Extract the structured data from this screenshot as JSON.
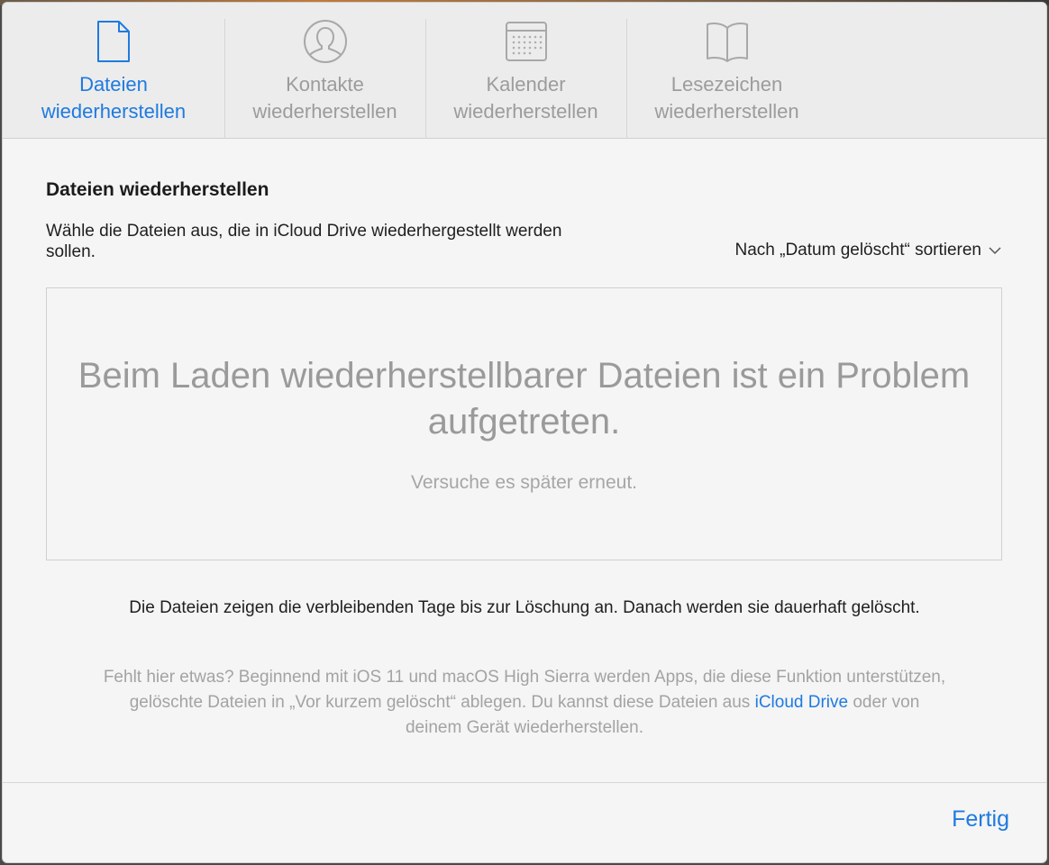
{
  "tabs": [
    {
      "label_line1": "Dateien",
      "label_line2": "wiederherstellen",
      "icon": "document-icon",
      "active": true
    },
    {
      "label_line1": "Kontakte",
      "label_line2": "wiederherstellen",
      "icon": "contact-icon",
      "active": false
    },
    {
      "label_line1": "Kalender",
      "label_line2": "wiederherstellen",
      "icon": "calendar-icon",
      "active": false
    },
    {
      "label_line1": "Lesezeichen",
      "label_line2": "wiederherstellen",
      "icon": "book-icon",
      "active": false
    }
  ],
  "main": {
    "title": "Dateien wiederherstellen",
    "instructions": "Wähle die Dateien aus, die in iCloud Drive wiederhergestellt werden sollen.",
    "sort_label": "Nach „Datum gelöscht“ sortieren",
    "error_title": "Beim Laden wiederherstellbarer Dateien ist ein Problem aufgetreten.",
    "error_subtitle": "Versuche es später erneut.",
    "info": "Die Dateien zeigen die verbleibenden Tage bis zur Löschung an. Danach werden sie dauerhaft gelöscht.",
    "help_before": "Fehlt hier etwas? Beginnend mit iOS 11 und macOS High Sierra werden Apps, die diese Funktion unterstützen, gelöschte Dateien in „Vor kurzem gelöscht“ ablegen. Du kannst diese Dateien aus ",
    "help_link": "iCloud Drive",
    "help_after": " oder von deinem Gerät wiederherstellen."
  },
  "footer": {
    "done_label": "Fertig"
  },
  "colors": {
    "accent": "#1f7ae0",
    "inactive": "#9c9c9c",
    "background": "#f4f5f4"
  }
}
